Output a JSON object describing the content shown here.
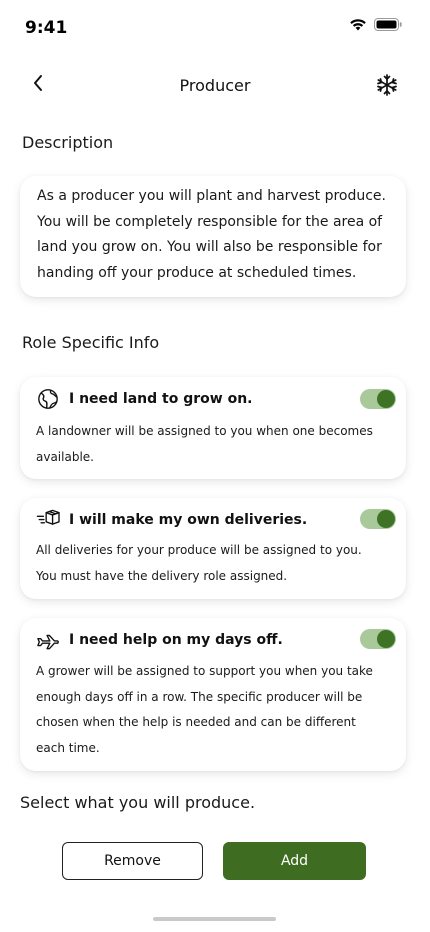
{
  "status_bar": {
    "time": "9:41"
  },
  "header": {
    "title": "Producer"
  },
  "description": {
    "heading": "Description",
    "text": "As a producer you will plant and harvest produce. You will be completely responsible for the area of land you grow on. You will also be responsible for handing off your produce at scheduled times."
  },
  "role_info": {
    "heading": "Role Specific Info",
    "items": [
      {
        "title": "I need land to grow on.",
        "description": "A landowner will be assigned to you when one becomes available.",
        "icon": "globe-icon",
        "enabled": true
      },
      {
        "title": "I will make my own deliveries.",
        "description": "All deliveries for your produce will be assigned to you. You must have the delivery role assigned.",
        "icon": "package-icon",
        "enabled": true
      },
      {
        "title": "I need help on my days off.",
        "description": "A grower will be assigned to support you when you take enough days off in a row. The specific producer will be chosen when the help is needed and can be different each time.",
        "icon": "plane-icon",
        "enabled": true
      }
    ]
  },
  "produce": {
    "label": "Select what you will produce."
  },
  "actions": {
    "remove_label": "Remove",
    "add_label": "Add"
  },
  "colors": {
    "accent": "#3e6d21",
    "toggle_track": "#a9c99a",
    "toggle_knob": "#3e7326"
  }
}
